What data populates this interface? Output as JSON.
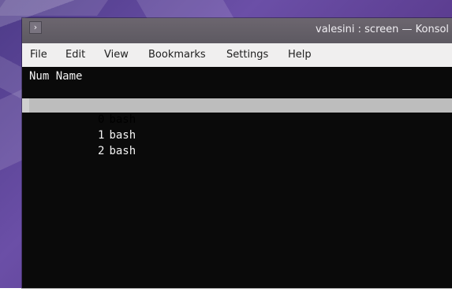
{
  "window": {
    "title": "valesini : screen — Konsol",
    "menu_button_glyph": "›"
  },
  "menubar": {
    "items": [
      {
        "label": "File"
      },
      {
        "label": "Edit"
      },
      {
        "label": "View"
      },
      {
        "label": "Bookmarks"
      },
      {
        "label": "Settings"
      },
      {
        "label": "Help"
      }
    ]
  },
  "terminal": {
    "header": "Num Name",
    "rows": [
      {
        "num": "0",
        "name": "bash",
        "selected": true
      },
      {
        "num": "1",
        "name": "bash",
        "selected": false
      },
      {
        "num": "2",
        "name": "bash",
        "selected": false
      }
    ]
  },
  "colors": {
    "terminal_bg": "#0a0a0a",
    "terminal_fg": "#f3f3f3",
    "selection_bg": "#bdbdbd",
    "menubar_bg": "#f0efef",
    "titlebar_bg": "#635f67"
  }
}
